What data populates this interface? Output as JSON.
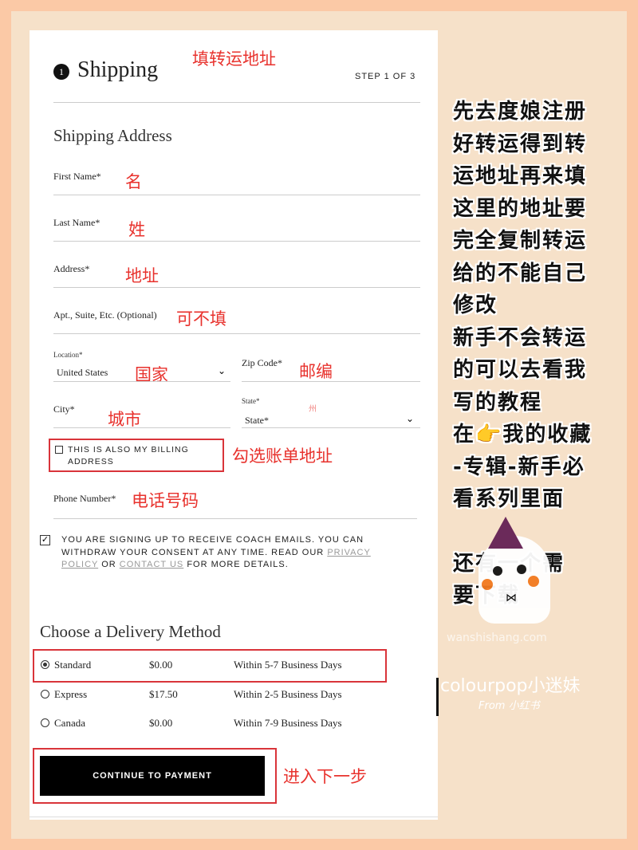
{
  "header": {
    "step_number": "1",
    "title": "Shipping",
    "step": "STEP 1 OF 3"
  },
  "section_title": "Shipping Address",
  "fields": {
    "first_name": "First Name*",
    "last_name": "Last Name*",
    "address": "Address*",
    "apt": "Apt., Suite, Etc. (Optional)",
    "location": "Location*",
    "location_value": "United States",
    "zip": "Zip Code*",
    "city": "City*",
    "state_label": "State*",
    "state_value": "State*",
    "phone": "Phone Number*"
  },
  "billing_checkbox": {
    "label_1": "THIS IS ALSO MY BILLING",
    "label_2": "ADDRESS",
    "checked": false
  },
  "consent": {
    "checked": true,
    "text_1": "YOU ARE SIGNING UP TO RECEIVE COACH EMAILS. YOU CAN",
    "text_2": "WITHDRAW YOUR CONSENT AT ANY TIME. READ OUR ",
    "privacy_1": "PRIVACY",
    "privacy_2": "POLICY",
    "or": " OR ",
    "contact": "CONTACT US",
    "tail": " FOR MORE DETAILS."
  },
  "delivery": {
    "title": "Choose a Delivery Method",
    "options": [
      {
        "name": "Standard",
        "price": "$0.00",
        "time": "Within 5-7 Business Days",
        "selected": true
      },
      {
        "name": "Express",
        "price": "$17.50",
        "time": "Within 2-5 Business Days",
        "selected": false
      },
      {
        "name": "Canada",
        "price": "$0.00",
        "time": "Within 7-9 Business Days",
        "selected": false
      }
    ]
  },
  "continue_button": "CONTINUE TO PAYMENT",
  "annotations": {
    "title": "填转运地址",
    "first": "名",
    "last": "姓",
    "address": "地址",
    "apt": "可不填",
    "country": "国家",
    "zip": "邮编",
    "city": "城市",
    "state": "州",
    "billing": "勾选账单地址",
    "phone": "电话号码",
    "next": "进入下一步"
  },
  "side_note": [
    "先去度娘注册",
    "好转运得到转",
    "运地址再来填",
    "这里的地址要",
    "完全复制转运",
    "给的不能自己",
    "修改",
    "新手不会转运",
    "的可以去看我",
    "写的教程",
    "在👉我的收藏",
    "-专辑-新手必",
    "看系列里面",
    "",
    "还有一个需",
    "要下载"
  ],
  "watermark": {
    "site": "wanshishang.com",
    "brand": "colourpop小迷妹",
    "from": "From 小红书"
  },
  "colors": {
    "annotation": "#e8322d",
    "button": "#000000",
    "accent_bg": "#fbc9a6"
  }
}
